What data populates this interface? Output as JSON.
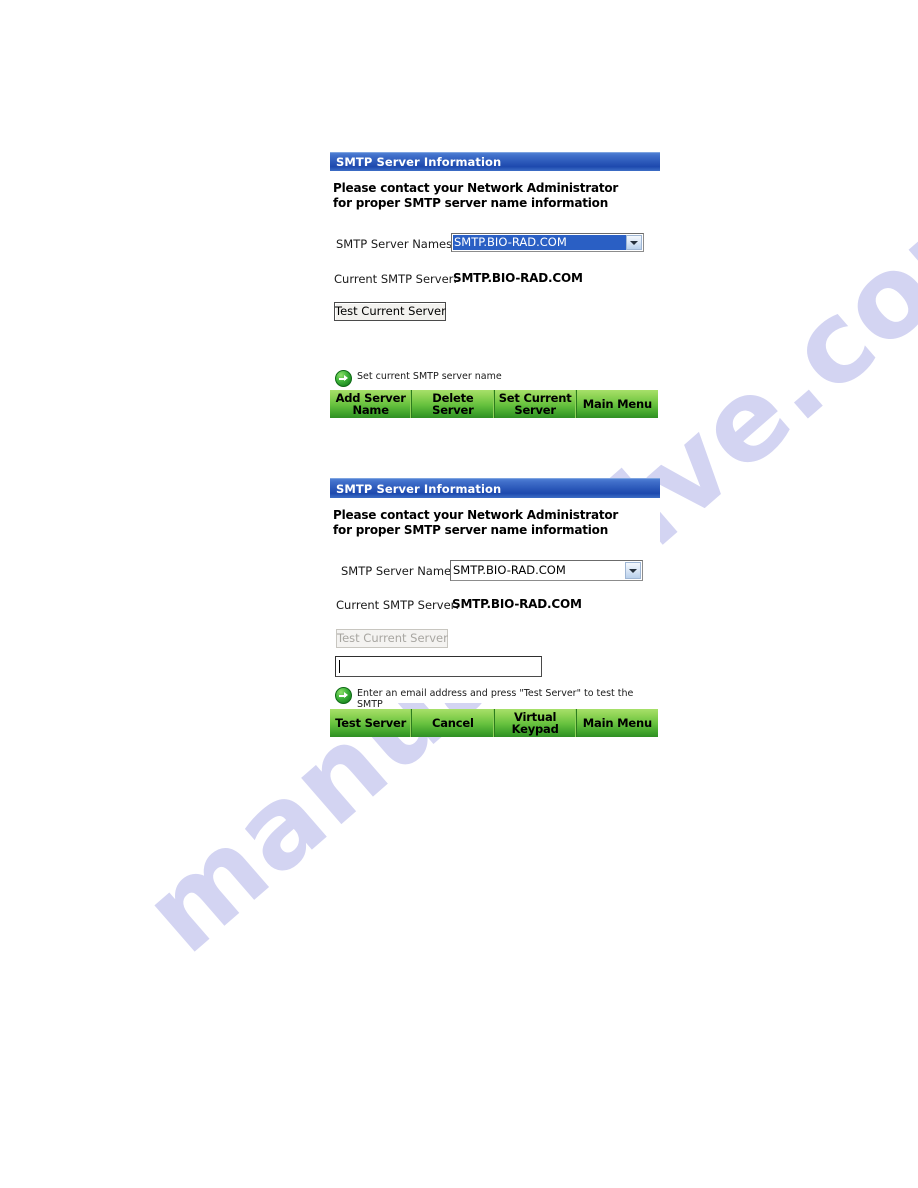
{
  "watermark": {
    "text": "manualshive.com"
  },
  "panels": [
    {
      "id": "panel-one",
      "title": "SMTP Server Information",
      "instruction": "Please contact your Network Administrator for proper SMTP server name information",
      "server_names_label": "SMTP Server Names:",
      "server_names_value": "SMTP.BIO-RAD.COM",
      "server_names_selected": true,
      "current_server_label": "Current SMTP Server:",
      "current_server_value": "SMTP.BIO-RAD.COM",
      "test_button_label": "Test Current Server",
      "test_button_enabled": true,
      "hint_icon": "green-arrow-icon",
      "hint_text": "Set current SMTP server name",
      "commands": [
        "Add Server\nName",
        "Delete\nServer",
        "Set Current\nServer",
        "Main Menu"
      ]
    },
    {
      "id": "panel-two",
      "title": "SMTP Server Information",
      "instruction": "Please contact your Network Administrator for proper SMTP server name information",
      "server_names_label": "SMTP Server Names:",
      "server_names_value": "SMTP.BIO-RAD.COM",
      "server_names_selected": false,
      "current_server_label": "Current SMTP Server:",
      "current_server_value": "SMTP.BIO-RAD.COM",
      "test_button_label": "Test Current Server",
      "test_button_enabled": false,
      "email_input_value": "",
      "email_input_placeholder": "",
      "hint_icon": "green-arrow-icon",
      "hint_text": "Enter an email address and press \"Test Server\" to test the SMTP\nserver address",
      "commands": [
        "Test Server",
        "Cancel",
        "Virtual\nKeypad",
        "Main Menu"
      ]
    }
  ],
  "colors": {
    "titlebar_blue": "#2a57b8",
    "command_green": "#68c23f",
    "selection_blue": "#2a5fc4",
    "watermark_violet": "#d3d4f2"
  }
}
